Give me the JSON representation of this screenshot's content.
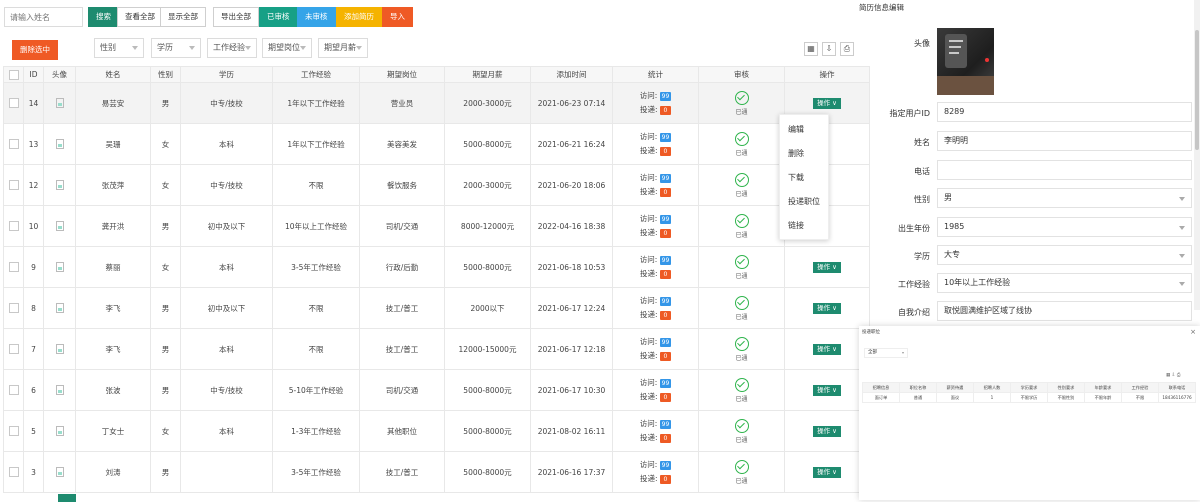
{
  "toolbar": {
    "search_placeholder": "请输入姓名",
    "search": "搜索",
    "view_all": "查看全部",
    "show_all": "显示全部",
    "export_all": "导出全部",
    "approved": "已审核",
    "unapproved": "未审核",
    "add_resume": "添加简历",
    "import": "导入",
    "delete_selected": "删除选中"
  },
  "filters": [
    "性别",
    "学历",
    "工作经验",
    "期望岗位",
    "期望月薪"
  ],
  "columns": [
    "ID",
    "头像",
    "姓名",
    "性别",
    "学历",
    "工作经验",
    "期望岗位",
    "期望月薪",
    "添加时间",
    "统计",
    "审核",
    "操作"
  ],
  "stat_labels": {
    "visit": "访问:",
    "apply": "投递:"
  },
  "audit_text": "已通",
  "op_label": "操作",
  "rows": [
    {
      "id": "14",
      "name": "易芸安",
      "gender": "男",
      "edu": "中专/技校",
      "exp": "1年以下工作经验",
      "job": "营业员",
      "salary": "2000-3000元",
      "time": "2021-06-23 07:14",
      "visits": "99",
      "applies": "0",
      "op": true
    },
    {
      "id": "13",
      "name": "吴珊",
      "gender": "女",
      "edu": "本科",
      "exp": "1年以下工作经验",
      "job": "美容美发",
      "salary": "5000-8000元",
      "time": "2021-06-21 16:24",
      "visits": "99",
      "applies": "0",
      "op": false
    },
    {
      "id": "12",
      "name": "张茂萍",
      "gender": "女",
      "edu": "中专/技校",
      "exp": "不限",
      "job": "餐饮服务",
      "salary": "2000-3000元",
      "time": "2021-06-20 18:06",
      "visits": "99",
      "applies": "0",
      "op": false
    },
    {
      "id": "10",
      "name": "龚开洪",
      "gender": "男",
      "edu": "初中及以下",
      "exp": "10年以上工作经验",
      "job": "司机/交通",
      "salary": "8000-12000元",
      "time": "2022-04-16 18:38",
      "visits": "99",
      "applies": "0",
      "op": false
    },
    {
      "id": "9",
      "name": "蔡丽",
      "gender": "女",
      "edu": "本科",
      "exp": "3-5年工作经验",
      "job": "行政/后勤",
      "salary": "5000-8000元",
      "time": "2021-06-18 10:53",
      "visits": "99",
      "applies": "0",
      "op": true
    },
    {
      "id": "8",
      "name": "李飞",
      "gender": "男",
      "edu": "初中及以下",
      "exp": "不限",
      "job": "技工/普工",
      "salary": "2000以下",
      "time": "2021-06-17 12:24",
      "visits": "99",
      "applies": "0",
      "op": true
    },
    {
      "id": "7",
      "name": "李飞",
      "gender": "男",
      "edu": "本科",
      "exp": "不限",
      "job": "技工/普工",
      "salary": "12000-15000元",
      "time": "2021-06-17 12:18",
      "visits": "99",
      "applies": "0",
      "op": true
    },
    {
      "id": "6",
      "name": "张波",
      "gender": "男",
      "edu": "中专/技校",
      "exp": "5-10年工作经验",
      "job": "司机/交通",
      "salary": "5000-8000元",
      "time": "2021-06-17 10:30",
      "visits": "99",
      "applies": "0",
      "op": true
    },
    {
      "id": "5",
      "name": "丁女士",
      "gender": "女",
      "edu": "本科",
      "exp": "1-3年工作经验",
      "job": "其他职位",
      "salary": "5000-8000元",
      "time": "2021-08-02 16:11",
      "visits": "99",
      "applies": "0",
      "op": true
    },
    {
      "id": "3",
      "name": "刘涛",
      "gender": "男",
      "edu": "",
      "exp": "3-5年工作经验",
      "job": "技工/普工",
      "salary": "5000-8000元",
      "time": "2021-06-16 17:37",
      "visits": "99",
      "applies": "0",
      "op": true
    }
  ],
  "dropdown": [
    "编辑",
    "删除",
    "下载",
    "投递职位",
    "链接"
  ],
  "edit_panel": {
    "title": "简历信息编辑",
    "avatar_label": "头像",
    "fields": [
      {
        "label": "指定用户ID",
        "value": "8289",
        "select": false
      },
      {
        "label": "姓名",
        "value": "李明明",
        "select": false
      },
      {
        "label": "电话",
        "value": "",
        "select": false
      },
      {
        "label": "性别",
        "value": "男",
        "select": true
      },
      {
        "label": "出生年份",
        "value": "1985",
        "select": true
      },
      {
        "label": "学历",
        "value": "大专",
        "select": true
      },
      {
        "label": "工作经验",
        "value": "10年以上工作经验",
        "select": true
      },
      {
        "label": "自我介绍",
        "value": "取悦圆满维护区域了线协",
        "select": false
      }
    ]
  },
  "popup": {
    "title": "投递职位",
    "filter": "全部",
    "columns": [
      "招聘信息",
      "职位名称",
      "薪资待遇",
      "招聘人数",
      "学历要求",
      "性别要求",
      "年龄要求",
      "工作经验",
      "联系电话"
    ],
    "row": [
      "面订单",
      "普通",
      "面议",
      "1",
      "不限学历",
      "不限性别",
      "不限年龄",
      "不限",
      "18436116776"
    ]
  }
}
